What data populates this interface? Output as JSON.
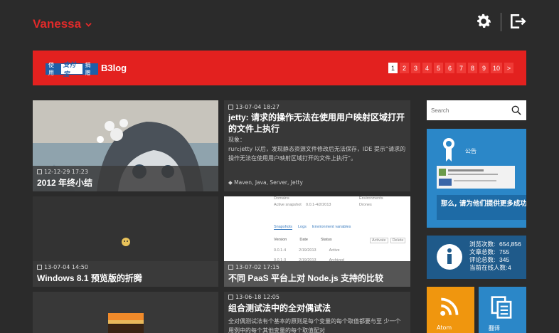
{
  "header": {
    "user_name": "Vanessa"
  },
  "banner": {
    "badge": {
      "left": "使用",
      "middle": "支付宝",
      "right": "捐赠"
    },
    "blog_name": "B3log",
    "pages": [
      "1",
      "2",
      "3",
      "4",
      "5",
      "6",
      "7",
      "8",
      "9",
      "10",
      ">"
    ]
  },
  "posts": [
    {
      "date": "12-12-29 17:23",
      "title": "2012 年终小结"
    },
    {
      "date": "13-07-04 18:27",
      "title": "jetty: 请求的操作无法在使用用户映射区域打开的文件上执行",
      "excerpt": "现象：\nrun:jetty 以后，发现静态资源文件修改后无法保存，IDE 提示“请求的操作无法在使用用户映射区域打开的文件上执行”。",
      "tags": "Maven, Java, Server, Jetty"
    },
    {
      "date": "13-07-04 14:50",
      "title": "Windows 8.1 预览版的折腾"
    },
    {
      "date": "13-07-02 17:15",
      "title": "不同 PaaS 平台上对 Node.js 支持的比较"
    },
    {
      "date": "13-06-18 12:05",
      "title": "组合测试法中的全对偶试法",
      "excerpt": "全对偶测试法有个基本的原则是每个变量的每个取值都要与至 少一个用例中的每个其他变量的每个取值配对"
    }
  ],
  "screenshot_preview": {
    "top_labels": [
      "Domains",
      "Environments",
      "Active snapshot",
      "0.0.1-4/2/2013",
      "Drones"
    ],
    "tabs": [
      "Snapshots",
      "Logs",
      "Environment variables"
    ],
    "columns": [
      "Version",
      "Date",
      "Status"
    ],
    "rows": [
      {
        "version": "0.0.1-4",
        "date": "2/19/2013",
        "status": "Active"
      },
      {
        "version": "0.0.1-3",
        "date": "2/19/2013",
        "status": "Archived"
      }
    ],
    "actions": [
      "Activate",
      "Delete"
    ]
  },
  "sidebar": {
    "search_placeholder": "Search",
    "notice": {
      "label": "公告",
      "marquee": "那么, 请为他们提供更多成功"
    },
    "stats": [
      {
        "k": "浏览次数:",
        "v": "654,856"
      },
      {
        "k": "文章总数:",
        "v": "755"
      },
      {
        "k": "评论总数:",
        "v": "345"
      },
      {
        "k": "当前在线人数:",
        "v": "4"
      }
    ],
    "atom_label": "Atom",
    "archive_label": "翻译"
  },
  "colors": {
    "accent": "#e3211f",
    "blue_tile": "#2b87c8",
    "dark_blue_tile": "#1f5a8a",
    "orange_tile": "#f0960e"
  }
}
